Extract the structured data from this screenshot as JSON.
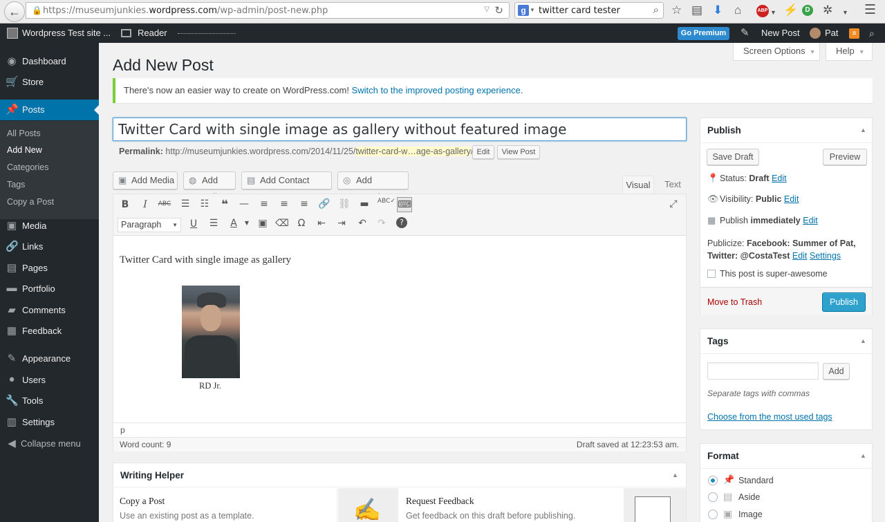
{
  "browser": {
    "url_prefix": "https://museumjunkies.",
    "url_domain": "wordpress.com",
    "url_path": "/wp-admin/post-new.php",
    "search_engine": "g",
    "search_query": "twitter card tester"
  },
  "adminbar": {
    "site_name": "Wordpress Test site ...",
    "reader": "Reader",
    "go_premium": "Go Premium",
    "new_post": "New Post",
    "user": "Pat"
  },
  "sidebar": {
    "items": [
      {
        "label": "Dashboard",
        "icon": "dashboard-icon",
        "glyph": "◉"
      },
      {
        "label": "Store",
        "icon": "cart-icon",
        "glyph": "🛒"
      },
      {
        "label": "Posts",
        "icon": "pushpin-icon",
        "glyph": "📌"
      },
      {
        "label": "Media",
        "icon": "media-icon",
        "glyph": "▣"
      },
      {
        "label": "Links",
        "icon": "links-icon",
        "glyph": "🔗"
      },
      {
        "label": "Pages",
        "icon": "pages-icon",
        "glyph": "▤"
      },
      {
        "label": "Portfolio",
        "icon": "portfolio-icon",
        "glyph": "▬"
      },
      {
        "label": "Comments",
        "icon": "comments-icon",
        "glyph": "▰"
      },
      {
        "label": "Feedback",
        "icon": "feedback-icon",
        "glyph": "▦"
      },
      {
        "label": "Appearance",
        "icon": "appearance-icon",
        "glyph": "✎"
      },
      {
        "label": "Users",
        "icon": "users-icon",
        "glyph": "●"
      },
      {
        "label": "Tools",
        "icon": "tools-icon",
        "glyph": "🔧"
      },
      {
        "label": "Settings",
        "icon": "settings-icon",
        "glyph": "▥"
      },
      {
        "label": "Collapse menu",
        "icon": "collapse-icon",
        "glyph": "◀"
      }
    ],
    "submenu": [
      "All Posts",
      "Add New",
      "Categories",
      "Tags",
      "Copy a Post"
    ]
  },
  "screen_options": "Screen Options",
  "help": "Help",
  "page_title": "Add New Post",
  "notice": {
    "text": "There's now an easier way to create on WordPress.com! ",
    "link": "Switch to the improved posting experience",
    "end": "."
  },
  "post": {
    "title": "Twitter Card with single image as gallery without featured image",
    "permalink_label": "Permalink:",
    "permalink_base": "http://museumjunkies.wordpress.com/2014/11/25/",
    "permalink_slug": "twitter-card-w…age-as-gallery",
    "permalink_end": "/",
    "edit_btn": "Edit",
    "view_btn": "View Post"
  },
  "media_buttons": [
    "Add Media",
    "Add Poll",
    "Add Contact Form",
    "Add Location"
  ],
  "editor_tabs": {
    "visual": "Visual",
    "text": "Text"
  },
  "editor": {
    "format": "Paragraph",
    "content": "Twitter Card with single image as gallery",
    "caption": "RD Jr.",
    "path": "p",
    "word_count": "Word count: 9",
    "draft_saved": "Draft saved at 12:23:53 am."
  },
  "writing_helper": {
    "title": "Writing Helper",
    "copy_title": "Copy a Post",
    "copy_desc": "Use an existing post as a template.",
    "feedback_title": "Request Feedback",
    "feedback_desc": "Get feedback on this draft before publishing."
  },
  "publish": {
    "title": "Publish",
    "save_draft": "Save Draft",
    "preview": "Preview",
    "status_label": "Status:",
    "status_value": "Draft",
    "visibility_label": "Visibility:",
    "visibility_value": "Public",
    "publish_label": "Publish",
    "publish_value": "immediately",
    "edit": "Edit",
    "publicize_label": "Publicize:",
    "publicize_facebook": "Facebook: Summer of Pat,",
    "publicize_twitter": "Twitter: @CostaTest",
    "settings": "Settings",
    "super_awesome": "This post is super-awesome",
    "trash": "Move to Trash",
    "publish_btn": "Publish"
  },
  "tags": {
    "title": "Tags",
    "add": "Add",
    "hint": "Separate tags with commas",
    "choose": "Choose from the most used tags"
  },
  "format": {
    "title": "Format",
    "options": [
      "Standard",
      "Aside",
      "Image"
    ],
    "selected": "Standard"
  },
  "colors": {
    "wp_blue": "#0073aa",
    "admin_dark": "#23282d",
    "notice_green": "#7ad03a",
    "trash_red": "#a00"
  }
}
